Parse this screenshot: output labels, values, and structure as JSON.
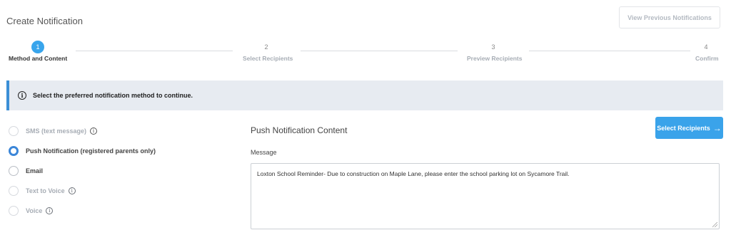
{
  "page": {
    "title": "Create Notification",
    "previous_button": "View Previous Notifications"
  },
  "stepper": {
    "steps": [
      {
        "number": "1",
        "label": "Method and Content",
        "active": true
      },
      {
        "number": "2",
        "label": "Select Recipients",
        "active": false
      },
      {
        "number": "3",
        "label": "Preview Recipients",
        "active": false
      },
      {
        "number": "4",
        "label": "Confirm",
        "active": false
      }
    ]
  },
  "info_bar": {
    "icon": "info-icon",
    "text": "Select the preferred notification method to continue."
  },
  "methods": {
    "selected": "Push Notification (registered parents only)",
    "options": [
      {
        "label": "SMS (text message)",
        "enabled": false,
        "has_info": true
      },
      {
        "label": "Push Notification (registered parents only)",
        "enabled": true,
        "has_info": false
      },
      {
        "label": "Email",
        "enabled": true,
        "has_info": false
      },
      {
        "label": "Text to Voice",
        "enabled": false,
        "has_info": true
      },
      {
        "label": "Voice",
        "enabled": false,
        "has_info": true
      }
    ]
  },
  "content": {
    "title": "Push Notification Content",
    "select_button": "Select Recipients",
    "message_label": "Message",
    "message_value": "Loxton School Reminder- Due to construction on Maple Lane, please enter the school parking lot on Sycamore Trail."
  },
  "colors": {
    "accent": "#39a5ec",
    "info_border": "#3b8fd6",
    "info_bg": "#e7ebf1"
  }
}
